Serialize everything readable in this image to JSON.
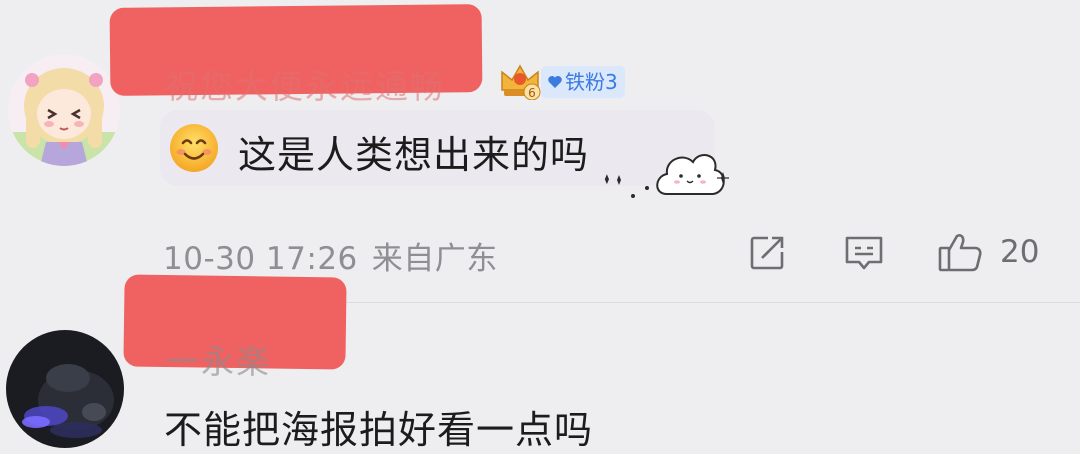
{
  "comments": [
    {
      "username": "祝您大便永远通畅",
      "fan_badge": {
        "label": "铁粉3",
        "icon": "heart-icon"
      },
      "crown_badge": {
        "icon": "crown-badge-icon",
        "level": "6"
      },
      "emoji": "smiling-face-emoji",
      "text": "这是人类想出来的吗",
      "sticker": "cloud-sticker",
      "timestamp": "10-30 17:26",
      "location": "来自广东",
      "actions": {
        "share_icon": "share-icon",
        "reply_icon": "comment-icon",
        "like_icon": "thumbs-up-icon",
        "like_count": "20"
      }
    },
    {
      "username": "一永楽",
      "text": "不能把海报拍好看一点吗"
    }
  ],
  "colors": {
    "background": "#eeeef0",
    "redaction": "#ef5c5c",
    "fan_badge_bg": "#dbe7fb",
    "fan_badge_text": "#3a7be0",
    "meta_text": "#8f8f93"
  }
}
